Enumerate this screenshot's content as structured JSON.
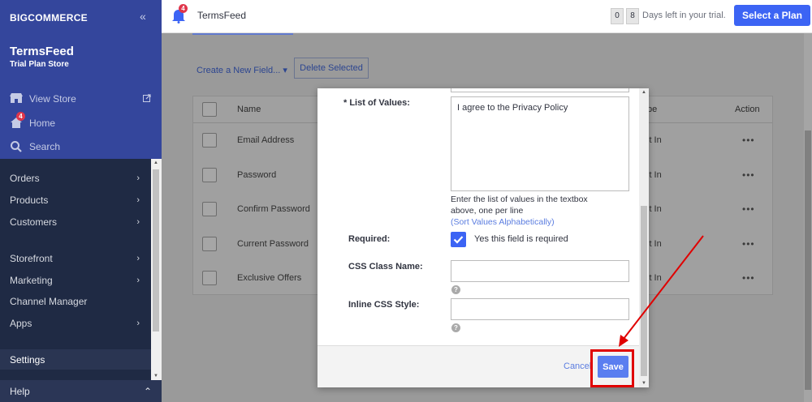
{
  "sidebar": {
    "logo": "BIGCOMMERCE",
    "store_name": "TermsFeed",
    "store_plan": "Trial Plan Store",
    "links": [
      {
        "label": "View Store",
        "icon": "storefront-icon"
      },
      {
        "label": "Home",
        "icon": "home-icon",
        "badge": "4"
      },
      {
        "label": "Search",
        "icon": "search-icon"
      }
    ],
    "nav": [
      {
        "label": "Orders"
      },
      {
        "label": "Products"
      },
      {
        "label": "Customers"
      },
      {
        "label": "Storefront"
      },
      {
        "label": "Marketing"
      },
      {
        "label": "Channel Manager"
      },
      {
        "label": "Apps"
      },
      {
        "label": "Settings"
      }
    ],
    "help": "Help"
  },
  "topbar": {
    "notification_badge": "4",
    "title": "TermsFeed",
    "trial_digits": [
      "0",
      "8"
    ],
    "trial_text": "Days left in your trial.",
    "select_plan": "Select a Plan"
  },
  "main": {
    "create_field": "Create a New Field... ▾",
    "delete_selected": "Delete Selected",
    "columns": {
      "name": "Name",
      "type": "pe",
      "action": "Action"
    },
    "rows": [
      {
        "name": "Email Address",
        "type": "lt In",
        "action": "•••"
      },
      {
        "name": "Password",
        "type": "lt In",
        "action": "•••"
      },
      {
        "name": "Confirm Password",
        "type": "lt In",
        "action": "•••"
      },
      {
        "name": "Current Password",
        "type": "lt In",
        "action": "•••"
      },
      {
        "name": "Exclusive Offers",
        "type": "lt In",
        "action": "•••"
      }
    ]
  },
  "modal": {
    "list_label": "* List of Values:",
    "list_value": "I agree to the Privacy Policy",
    "list_help": "Enter the list of values in the textbox above, one per line",
    "sort_link": "(Sort Values Alphabetically)",
    "required_label": "Required:",
    "required_text": "Yes this field is required",
    "css_class_label": "CSS Class Name:",
    "inline_css_label": "Inline CSS Style:",
    "help_glyph": "?",
    "cancel": "Cancel",
    "save": "Save"
  },
  "colors": {
    "brand_blue": "#3c64f4",
    "sidebar_top": "#34469c",
    "sidebar": "#1f2a44",
    "annotation_red": "#e00000"
  }
}
